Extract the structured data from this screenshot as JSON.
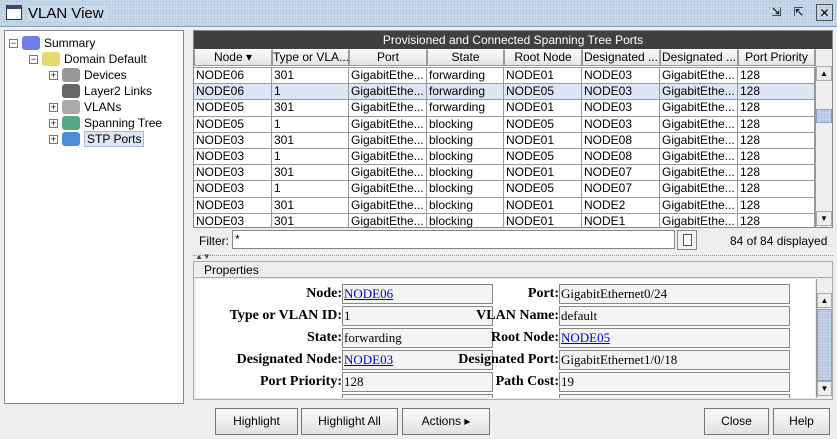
{
  "window": {
    "title": "VLAN View",
    "buttons": [
      "restore-icon",
      "maximize-icon",
      "close-icon"
    ]
  },
  "tree": [
    {
      "label": "Summary",
      "expander": "−",
      "icon": "summary-icon"
    },
    {
      "label": "Domain Default",
      "expander": "−",
      "icon": "folder-icon"
    },
    {
      "label": "Devices",
      "expander": "+",
      "icon": "devices-icon"
    },
    {
      "label": "Layer2 Links",
      "expander": "",
      "icon": "link-icon"
    },
    {
      "label": "VLANs",
      "expander": "+",
      "icon": "vlan-icon"
    },
    {
      "label": "Spanning Tree",
      "expander": "+",
      "icon": "spanning-tree-icon"
    },
    {
      "label": "STP Ports",
      "expander": "+",
      "icon": "stp-ports-icon",
      "selected": true
    }
  ],
  "table": {
    "title": "Provisioned and Connected Spanning Tree Ports",
    "columns": [
      "Node ▾",
      "Type or VLA...",
      "Port",
      "State",
      "Root Node",
      "Designated ...",
      "Designated ...",
      "Port Priority"
    ],
    "rows": [
      [
        "NODE06",
        "301",
        "GigabitEthe...",
        "forwarding",
        "NODE01",
        "NODE03",
        "GigabitEthe...",
        "128"
      ],
      [
        "NODE06",
        "1",
        "GigabitEthe...",
        "forwarding",
        "NODE05",
        "NODE03",
        "GigabitEthe...",
        "128"
      ],
      [
        "NODE05",
        "301",
        "GigabitEthe...",
        "forwarding",
        "NODE01",
        "NODE03",
        "GigabitEthe...",
        "128"
      ],
      [
        "NODE05",
        "1",
        "GigabitEthe...",
        "blocking",
        "NODE05",
        "NODE03",
        "GigabitEthe...",
        "128"
      ],
      [
        "NODE03",
        "301",
        "GigabitEthe...",
        "blocking",
        "NODE01",
        "NODE08",
        "GigabitEthe...",
        "128"
      ],
      [
        "NODE03",
        "1",
        "GigabitEthe...",
        "blocking",
        "NODE05",
        "NODE08",
        "GigabitEthe...",
        "128"
      ],
      [
        "NODE03",
        "301",
        "GigabitEthe...",
        "blocking",
        "NODE01",
        "NODE07",
        "GigabitEthe...",
        "128"
      ],
      [
        "NODE03",
        "1",
        "GigabitEthe...",
        "blocking",
        "NODE05",
        "NODE07",
        "GigabitEthe...",
        "128"
      ],
      [
        "NODE03",
        "301",
        "GigabitEthe...",
        "blocking",
        "NODE01",
        "NODE2",
        "GigabitEthe...",
        "128"
      ],
      [
        "NODE03",
        "301",
        "GigabitEthe...",
        "blocking",
        "NODE01",
        "NODE1",
        "GigabitEthe...",
        "128"
      ]
    ],
    "selected_row": 1
  },
  "filter": {
    "label": "Filter:",
    "value": "*",
    "count": "84 of 84 displayed"
  },
  "properties": {
    "title": "Properties",
    "left": [
      {
        "label": "Node:",
        "value": "NODE06",
        "link": true
      },
      {
        "label": "Type or VLAN ID:",
        "value": "1"
      },
      {
        "label": "State:",
        "value": "forwarding"
      },
      {
        "label": "Designated Node:",
        "value": "NODE03",
        "link": true
      },
      {
        "label": "Port Priority:",
        "value": "128"
      }
    ],
    "right": [
      {
        "label": "Port:",
        "value": "GigabitEthernet0/24"
      },
      {
        "label": "VLAN Name:",
        "value": "default"
      },
      {
        "label": "Root Node:",
        "value": "NODE05",
        "link": true
      },
      {
        "label": "Designated Port:",
        "value": "GigabitEthernet1/0/18"
      },
      {
        "label": "Path Cost:",
        "value": "19"
      }
    ]
  },
  "buttons": {
    "highlight": "Highlight",
    "highlight_all": "Highlight All",
    "actions": "Actions ▸",
    "close": "Close",
    "help": "Help"
  }
}
